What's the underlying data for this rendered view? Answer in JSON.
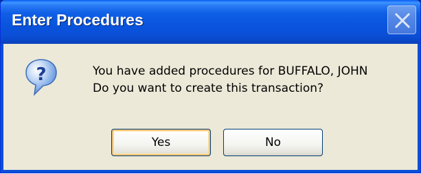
{
  "dialog": {
    "title": "Enter Procedures",
    "message_line1": "You have added procedures for BUFFALO, JOHN",
    "message_line2": "Do you want to create this transaction?",
    "icon": "question-icon",
    "buttons": {
      "yes_label": "Yes",
      "no_label": "No"
    },
    "close_icon": "close-icon"
  },
  "colors": {
    "titlebar": "#0b4fd7",
    "client": "#ece9d8",
    "default_button_highlight": "#f0c478"
  }
}
